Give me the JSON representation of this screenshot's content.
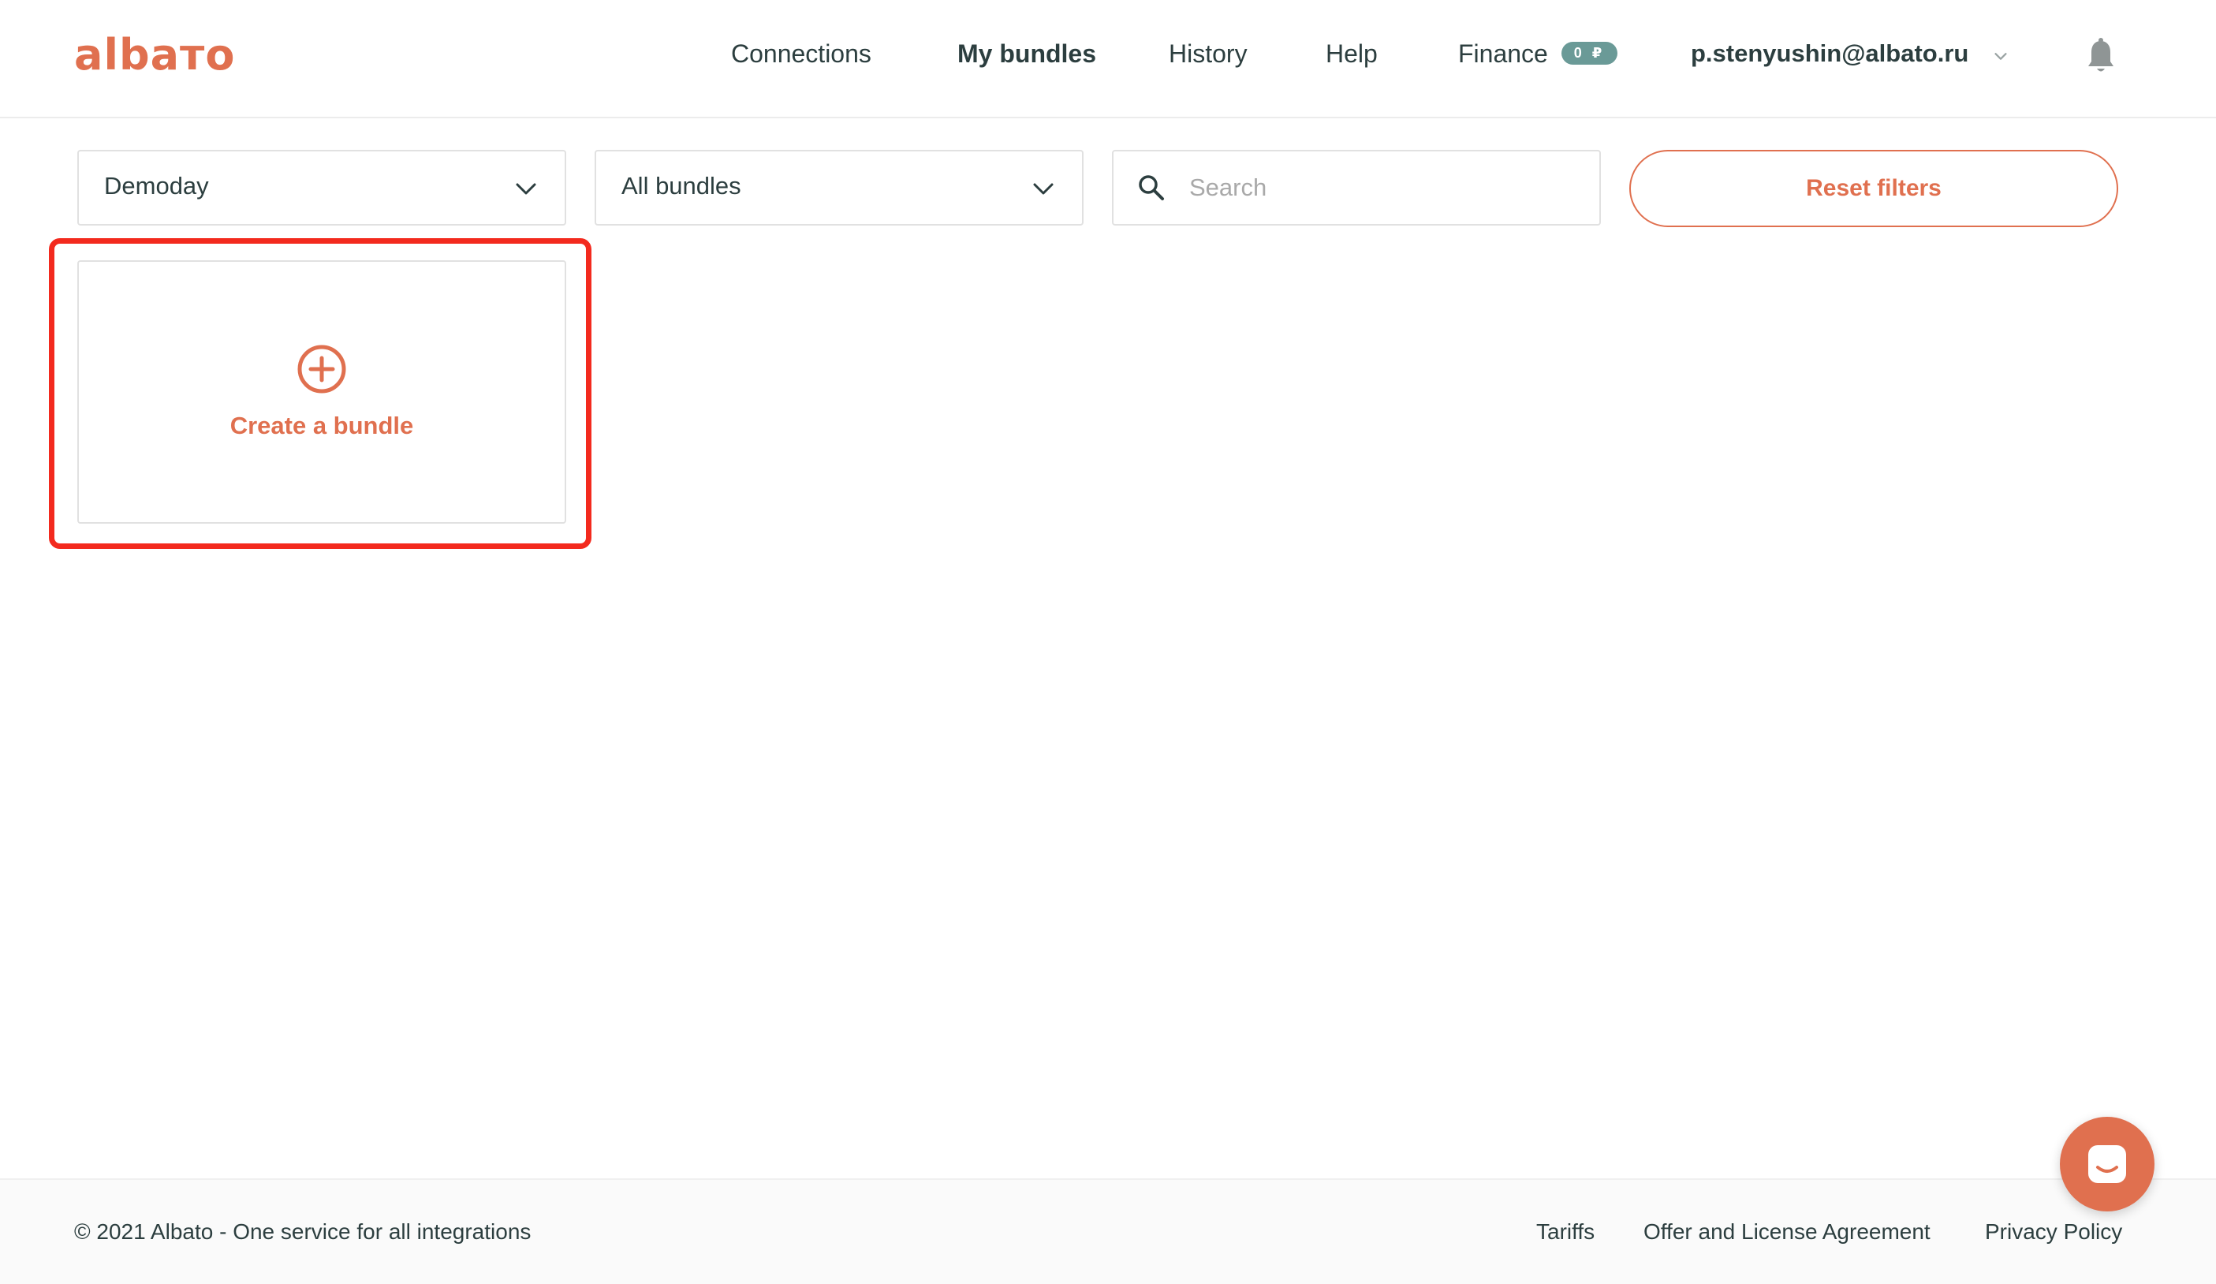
{
  "header": {
    "logo": "albaтo",
    "nav": [
      {
        "label": "Connections"
      },
      {
        "label": "My bundles",
        "active": true
      },
      {
        "label": "History"
      },
      {
        "label": "Help"
      },
      {
        "label": "Finance"
      }
    ],
    "finance_badge": "0 ₽",
    "user_email": "p.stenyushin@albato.ru"
  },
  "filters": {
    "workspace_select": "Demoday",
    "bundle_select": "All bundles",
    "search_placeholder": "Search",
    "reset_label": "Reset filters"
  },
  "create_card": {
    "label": "Create a bundle"
  },
  "footer": {
    "copyright": "© 2021 Albato - One service for all integrations",
    "links": [
      "Tariffs",
      "Offer and License Agreement",
      "Privacy Policy"
    ]
  },
  "colors": {
    "accent": "#e0704f",
    "highlight": "#f32a1e",
    "badge": "#6a9a97",
    "text": "#2c3e3f"
  }
}
